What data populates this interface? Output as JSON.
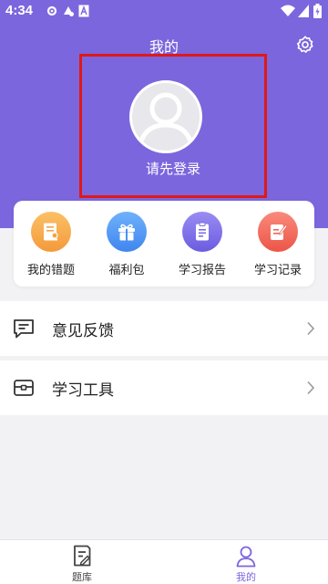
{
  "status_bar": {
    "time": "4:34"
  },
  "header": {
    "title": "我的"
  },
  "profile": {
    "login_prompt": "请先登录"
  },
  "quick_actions": [
    {
      "label": "我的错题",
      "icon": "wrong-questions-icon",
      "color": "#f9a94a"
    },
    {
      "label": "福利包",
      "icon": "gift-icon",
      "color": "#4a90f0"
    },
    {
      "label": "学习报告",
      "icon": "report-clipboard-icon",
      "color": "#7b6de8"
    },
    {
      "label": "学习记录",
      "icon": "study-record-icon",
      "color": "#f0655a"
    }
  ],
  "menu": [
    {
      "label": "意见反馈",
      "icon": "feedback-icon"
    },
    {
      "label": "学习工具",
      "icon": "tools-icon"
    }
  ],
  "tab_bar": [
    {
      "label": "题库",
      "icon": "question-bank-icon",
      "active": false
    },
    {
      "label": "我的",
      "icon": "profile-icon",
      "active": true
    }
  ],
  "colors": {
    "brand": "#7c66dd",
    "active_tab": "#7c66dd",
    "inactive_tab": "#444444",
    "highlight_border": "#e01818"
  }
}
